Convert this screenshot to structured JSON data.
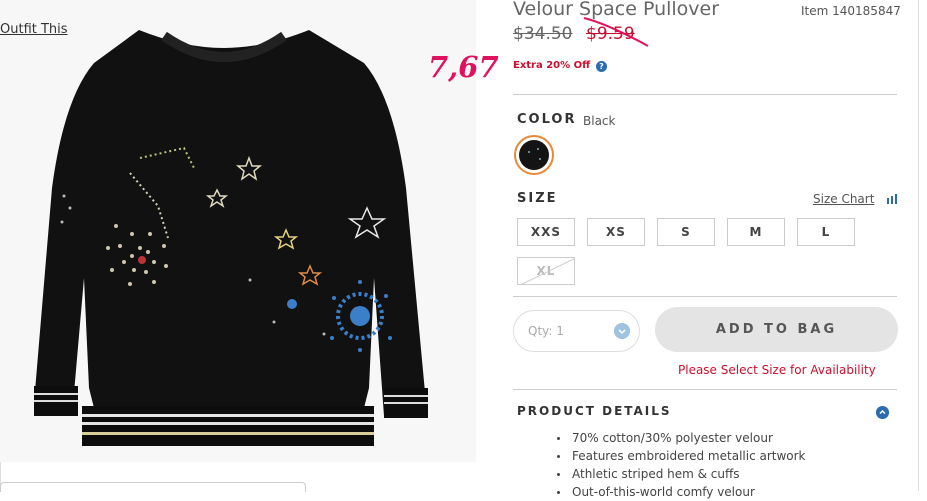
{
  "product": {
    "title": "Velour Space Pullover",
    "item_number": "Item 140185847",
    "price_original": "$34.50",
    "price_sale": "$9.59",
    "extra_offer": "Extra 20% Off",
    "handwritten_note": "7,67"
  },
  "outfit_link": "Outfit This",
  "color": {
    "label": "COLOR",
    "value": "Black",
    "swatch_hex": "#141414",
    "selected_ring": "#e8893a"
  },
  "size": {
    "label": "SIZE",
    "chart_link": "Size Chart",
    "options": [
      "XXS",
      "XS",
      "S",
      "M",
      "L",
      "XL"
    ],
    "unavailable": "XL"
  },
  "quantity": {
    "text": "Qty: 1"
  },
  "add_to_bag": "ADD TO BAG",
  "size_message": "Please Select Size for Availability",
  "details": {
    "label": "PRODUCT DETAILS",
    "items": [
      "70% cotton/30% polyester velour",
      "Features embroidered metallic artwork",
      "Athletic striped hem & cuffs",
      "Out-of-this-world comfy velour"
    ]
  },
  "colors": {
    "sale": "#c8102e",
    "accent": "#2b6cb0",
    "note": "#e0115f"
  },
  "icons": [
    "info-icon",
    "bars-icon",
    "chevron-down-icon",
    "chevron-up-icon"
  ]
}
